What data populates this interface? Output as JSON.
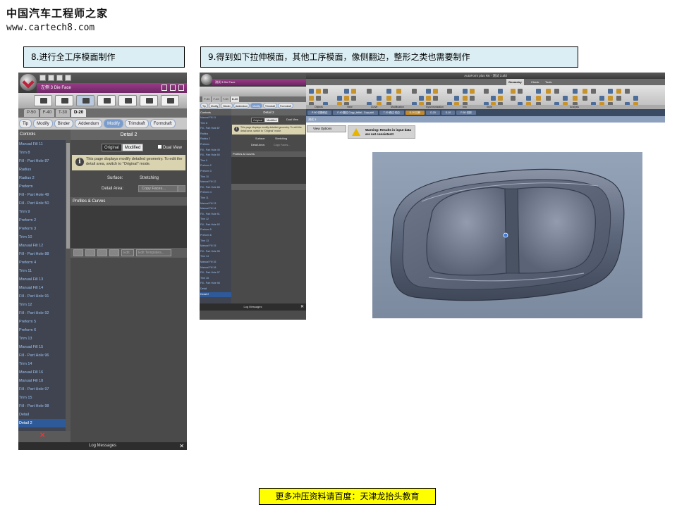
{
  "brand": {
    "name_cn": "中国汽车工程师之家",
    "url": "www.cartech8.com"
  },
  "captions": {
    "step8": "8.进行全工序模面制作",
    "step9": "9.得到如下拉伸模面，其他工序模面，像侧翻边，整形之类也需要制作"
  },
  "footer": "更多冲压资料请百度：天津龙抬头教育",
  "screenshot1": {
    "document_title": "左侧 3 Die Face",
    "operation_tabs": [
      {
        "label": "P-50",
        "selected": false
      },
      {
        "label": "F-40",
        "selected": false
      },
      {
        "label": "T-30",
        "selected": false
      },
      {
        "label": "D-20",
        "selected": true
      }
    ],
    "sub_tabs": [
      {
        "label": "Tip",
        "selected": false
      },
      {
        "label": "Modify",
        "selected": false
      },
      {
        "label": "Binder",
        "selected": false
      },
      {
        "label": "Addendum",
        "selected": false
      },
      {
        "label": "Modify",
        "selected": true
      },
      {
        "label": "Trimdraft",
        "selected": false
      },
      {
        "label": "Formdraft",
        "selected": false
      }
    ],
    "controls_header": "Controls",
    "tree_items": [
      "Manual Fill 11",
      "Trim 8",
      "Fill - Part Hole 87",
      "Radius",
      "Radius 2",
      "Preform",
      "Fill - Part Hole 49",
      "Fill - Part Hole 50",
      "Trim 9",
      "Preform 2",
      "Preform 3",
      "Trim 10",
      "Manual Fill 12",
      "Fill - Part Hole 88",
      "Preform 4",
      "Trim 11",
      "Manual Fill 13",
      "Manual Fill 14",
      "Fill - Part Hole 91",
      "Trim 12",
      "Fill - Part Hole 92",
      "Preform 5",
      "Preform 6",
      "Trim 13",
      "Manual Fill 15",
      "Fill - Part Hole 96",
      "Trim 14",
      "Manual Fill 16",
      "Manual Fill 18",
      "Fill - Part Hole 97",
      "Trim 15",
      "Fill - Part Hole 98",
      "Detail",
      "Detail 2"
    ],
    "selected_item": "Detail 2",
    "detail": {
      "header": "Detail 2",
      "toggle_original": "Original",
      "toggle_modified": "Modified",
      "dual_view": "Dual View",
      "info_text": "This page displays modify detailed geometry. To edit the detail area, switch to \"Original\" mode.",
      "surface_label": "Surface:",
      "surface_value": "Stretching",
      "detail_area_label": "Detail Area:",
      "detail_area_value": "Copy Faces...",
      "profiles_header": "Profiles & Curves",
      "edit_label": "Edit",
      "tool_label": "Edit Templates..."
    },
    "log_messages": "Log Messages"
  },
  "screenshot2": {
    "app_title": "AutoForm plus R6 - 测试 3.afd",
    "document_title": "测试 3 Die Face",
    "ribbon_tabs": [
      "Geometry",
      "Check",
      "Tools"
    ],
    "ribbon_groups": [
      "Objects",
      "View",
      "Curve",
      "Modification",
      "Synchronization",
      "Info",
      "Style",
      "Analysis"
    ],
    "operation_tabs": [
      "P-50",
      "F-40",
      "T-30",
      "D-20"
    ],
    "sub_tabs": [
      "Tip",
      "Modify",
      "Binder",
      "Addendum",
      "Modify",
      "Trimdraft",
      "Formdraft"
    ],
    "controls_header": "Controls",
    "tree_items": [
      "Manual Fill 11",
      "Trim 8",
      "Fill - Part Hole 87",
      "Radius",
      "Radius 2",
      "Preform",
      "Fill - Part Hole 49",
      "Fill - Part Hole 50",
      "Trim 9",
      "Preform 2",
      "Preform 3",
      "Trim 10",
      "Manual Fill 12",
      "Fill - Part Hole 88",
      "Preform 4",
      "Trim 11",
      "Manual Fill 13",
      "Manual Fill 14",
      "Fill - Part Hole 91",
      "Trim 12",
      "Fill - Part Hole 92",
      "Preform 5",
      "Preform 6",
      "Trim 13",
      "Manual Fill 15",
      "Fill - Part Hole 96",
      "Trim 14",
      "Manual Fill 16",
      "Manual Fill 18",
      "Fill - Part Hole 97",
      "Trim 15",
      "Fill - Part Hole 98",
      "Detail",
      "Detail 2"
    ],
    "detail_header": "Detail 2",
    "toggle_original": "Original",
    "toggle_modified": "Modified",
    "dual_view": "Dual View",
    "info_text": "This page displays modify detailed geometry. To edit the detail area, switch to \"Original\" mode.",
    "surface_label": "Surface:",
    "surface_value": "Stretching",
    "detail_area_label": "Detail Area:",
    "detail_area_value": "Copy Faces...",
    "profiles_header": "Profiles & Curves",
    "step_tabs": [
      {
        "label": "P-50 切割修边",
        "selected": false
      },
      {
        "label": "F-40 翻边 Copy_Initial - Copy.afd",
        "selected": false
      },
      {
        "label": "T-30 修边 切边",
        "selected": false
      },
      {
        "label": "D-20 拉伸",
        "selected": true
      },
      {
        "label": "D-20",
        "selected": false
      },
      {
        "label": "S-10",
        "selected": false
      },
      {
        "label": "P-50 切割",
        "selected": false
      }
    ],
    "view_label": "测试 3",
    "view_options": "View Options",
    "warning_text": "Warning: Results in input data are not consistent!",
    "log_messages": "Log Messages"
  },
  "colors": {
    "caption_bg": "#dbeef3",
    "footer_bg": "#ffff00",
    "app_dark": "#3c3c3c",
    "tree_text": "#9cc1f2",
    "selected_blue": "#2e5a99",
    "title_magenta": "#8a3380",
    "viewport_bg": "#8896ad"
  }
}
